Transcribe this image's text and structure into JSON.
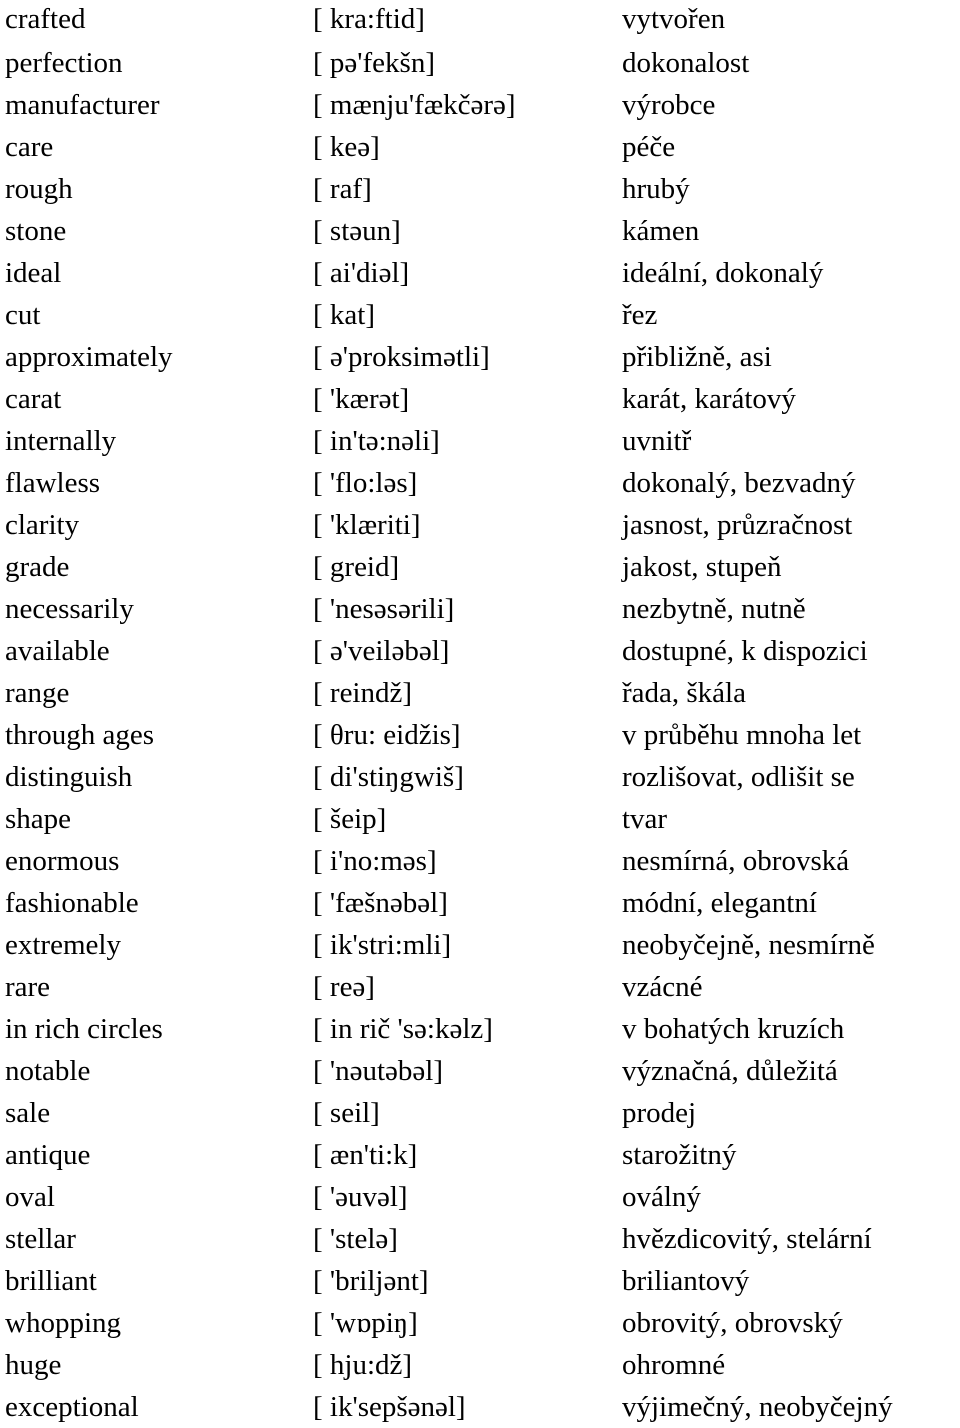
{
  "document": {
    "kind": "vocabulary-list",
    "columns": [
      "term",
      "pronunciation",
      "translation"
    ],
    "rows": [
      {
        "term": "crafted",
        "phon": "[ kra:ftid]",
        "trans": "vytvořen"
      },
      {
        "term": "perfection",
        "phon": "[ pə'fekšn]",
        "trans": "dokonalost"
      },
      {
        "term": "manufacturer",
        "phon": "[ mænju'fækčərə]",
        "trans": "výrobce"
      },
      {
        "term": "care",
        "phon": "[ keə]",
        "trans": "péče"
      },
      {
        "term": "rough",
        "phon": "[ raf]",
        "trans": "hrubý"
      },
      {
        "term": "stone",
        "phon": "[ stəun]",
        "trans": "kámen"
      },
      {
        "term": "ideal",
        "phon": "[ ai'diəl]",
        "trans": "ideální, dokonalý"
      },
      {
        "term": "cut",
        "phon": "[ kat]",
        "trans": "řez"
      },
      {
        "term": "approximately",
        "phon": "[ ə'proksimətli]",
        "trans": "přibližně, asi"
      },
      {
        "term": "carat",
        "phon": "[ 'kærət]",
        "trans": "karát, karátový"
      },
      {
        "term": "internally",
        "phon": "[ in'tə:nəli]",
        "trans": "uvnitř"
      },
      {
        "term": "flawless",
        "phon": "[ 'flo:ləs]",
        "trans": "dokonalý, bezvadný"
      },
      {
        "term": "clarity",
        "phon": "[ 'klæriti]",
        "trans": "jasnost, průzračnost"
      },
      {
        "term": "grade",
        "phon": "[ greid]",
        "trans": "jakost, stupeň"
      },
      {
        "term": "necessarily",
        "phon": "[ 'nesəsərili]",
        "trans": "nezbytně, nutně"
      },
      {
        "term": "available",
        "phon": "[ ə'veiləbəl]",
        "trans": "dostupné, k dispozici"
      },
      {
        "term": "range",
        "phon": "[ reindž]",
        "trans": "řada, škála"
      },
      {
        "term": "through ages",
        "phon": "[ θru: eidžis]",
        "trans": "v průběhu mnoha let"
      },
      {
        "term": "distinguish",
        "phon": "[ di'stiŋgwiš]",
        "trans": "rozlišovat, odlišit se"
      },
      {
        "term": "shape",
        "phon": "[ šeip]",
        "trans": "tvar"
      },
      {
        "term": "enormous",
        "phon": "[ i'no:məs]",
        "trans": "nesmírná, obrovská"
      },
      {
        "term": "fashionable",
        "phon": "[ 'fæšnəbəl]",
        "trans": "módní, elegantní"
      },
      {
        "term": "extremely",
        "phon": "[ ik'stri:mli]",
        "trans": "neobyčejně, nesmírně"
      },
      {
        "term": "rare",
        "phon": "[ reə]",
        "trans": "vzácné"
      },
      {
        "term": "in rich circles",
        "phon": "[ in rič 'sə:kəlz]",
        "trans": "v bohatých kruzích"
      },
      {
        "term": "notable",
        "phon": "[ 'nəutəbəl]",
        "trans": "význačná, důležitá"
      },
      {
        "term": "sale",
        "phon": "[ seil]",
        "trans": "prodej"
      },
      {
        "term": "antique",
        "phon": "[ æn'ti:k]",
        "trans": "starožitný"
      },
      {
        "term": "oval",
        "phon": "[ 'əuvəl]",
        "trans": "oválný"
      },
      {
        "term": "stellar",
        "phon": "[ 'stelə]",
        "trans": "hvězdicovitý, stelární"
      },
      {
        "term": "brilliant",
        "phon": "[ 'briljənt]",
        "trans": "briliantový"
      },
      {
        "term": "whopping",
        "phon": "[ 'wɒpiŋ]",
        "trans": "obrovitý, obrovský"
      },
      {
        "term": "huge",
        "phon": "[ hju:dž]",
        "trans": "ohromné"
      },
      {
        "term": "exceptional",
        "phon": "[ ik'sepšənəl]",
        "trans": "výjimečný, neobyčejný"
      }
    ]
  }
}
